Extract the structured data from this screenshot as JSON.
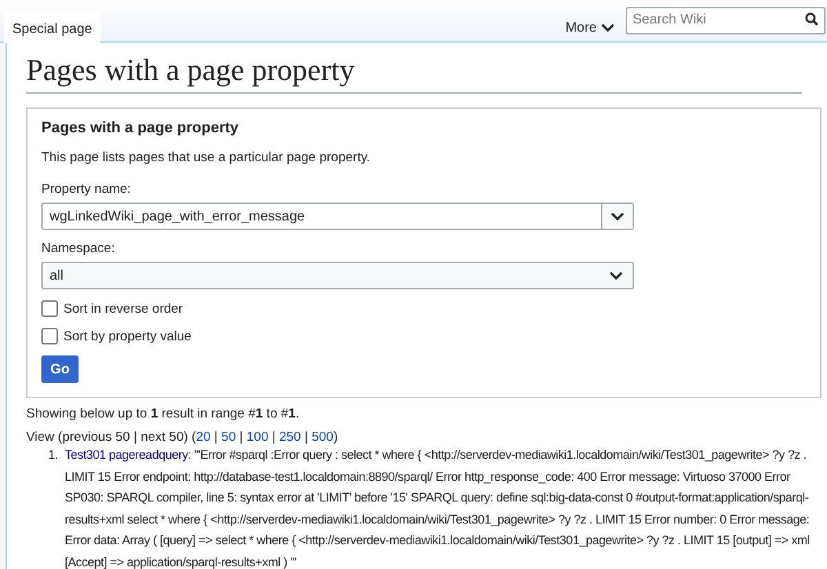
{
  "tabs": [
    {
      "label": "Special page",
      "selected": true
    }
  ],
  "more_menu": {
    "label": "More"
  },
  "search": {
    "placeholder": "Search Wiki"
  },
  "heading": "Pages with a page property",
  "form": {
    "legend": "Pages with a page property",
    "description": "This page lists pages that use a particular page property.",
    "fields": [
      {
        "kind": "combo",
        "label": "Property name:",
        "value": "wgLinkedWiki_page_with_error_message"
      },
      {
        "kind": "select",
        "label": "Namespace:",
        "value": "all"
      }
    ],
    "checkboxes": [
      {
        "label": "Sort in reverse order",
        "checked": false
      },
      {
        "label": "Sort by property value",
        "checked": false
      }
    ],
    "submit": "Go"
  },
  "summary": "Showing below up to **1** result in range #**1** to #**1**.",
  "view": {
    "prefix": "View (previous 50 | next 50) (",
    "limits": [
      "20",
      "50",
      "100",
      "250",
      "500"
    ],
    "separator": "|",
    "suffix": ")"
  },
  "results": [
    {
      "number": "1.",
      "link": "Test301 pagereadquery",
      "text": ": '''Error #sparql :Error query : select * where { <http://serverdev-mediawiki1.localdomain/wiki/Test301_pagewrite> ?y ?z . LIMIT 15 Error endpoint: http://database-test1.localdomain:8890/sparql/ Error http_response_code: 400 Error message: Virtuoso 37000 Error SP030: SPARQL compiler, line 5: syntax error at 'LIMIT' before '15' SPARQL query: define sql:big-data-const 0 #output-format:application/sparql-results+xml select * where { <http://serverdev-mediawiki1.localdomain/wiki/Test301_pagewrite> ?y ?z . LIMIT 15 Error number: 0 Error message: Error data: Array ( [query] => select * where { <http://serverdev-mediawiki1.localdomain/wiki/Test301_pagewrite> ?y ?z . LIMIT 15 [output] => xml [Accept] => application/sparql-results+xml ) '''"
    }
  ]
}
